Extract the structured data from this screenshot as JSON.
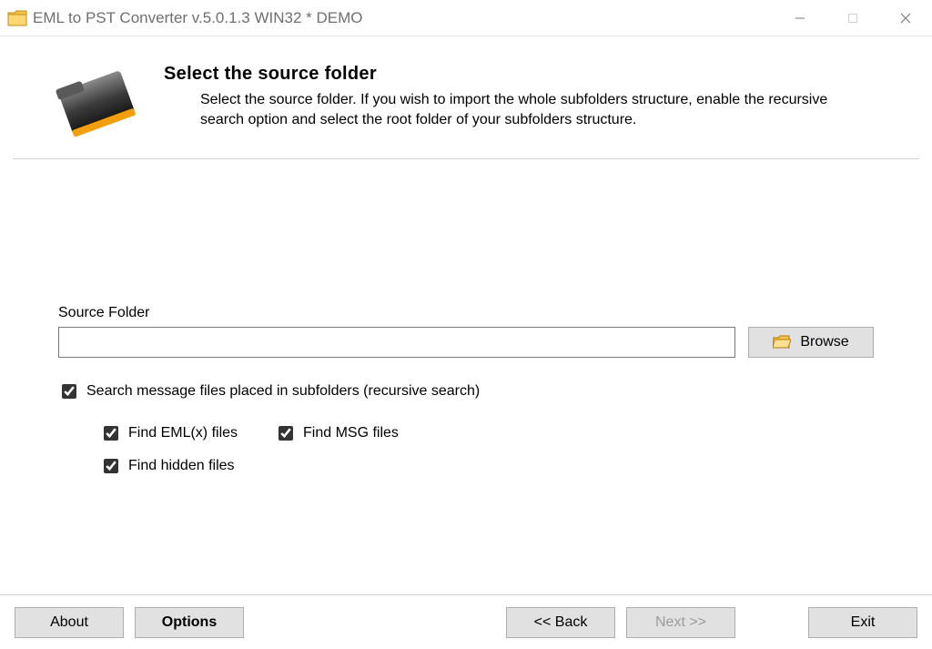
{
  "window": {
    "title": "EML to PST Converter v.5.0.1.3 WIN32 * DEMO"
  },
  "header": {
    "heading": "Select the source folder",
    "description": "Select the source folder. If you wish to import the whole subfolders structure, enable the recursive search option and select the root folder of your subfolders structure."
  },
  "form": {
    "source_label": "Source Folder",
    "source_value": "",
    "browse_label": "Browse",
    "recursive_label": "Search message files placed in subfolders (recursive search)",
    "find_emlx_label": "Find EML(x) files",
    "find_msg_label": "Find MSG files",
    "find_hidden_label": "Find hidden files"
  },
  "footer": {
    "about": "About",
    "options": "Options",
    "back": "<< Back",
    "next": "Next >>",
    "exit": "Exit"
  }
}
